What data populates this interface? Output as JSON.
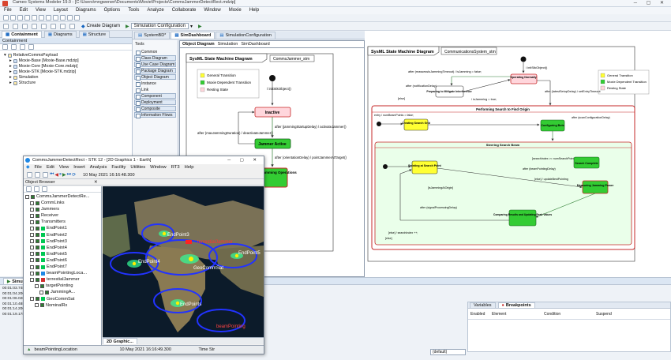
{
  "window": {
    "title": "Cameo Systems Modeler 19.0 - [C:\\Users\\mngweneri\\Documents\\Movie\\Projects\\CommsJammerDetectRect.mdzip]"
  },
  "menu": [
    "File",
    "Edit",
    "View",
    "Layout",
    "Diagrams",
    "Options",
    "Tools",
    "Analyze",
    "Collaborate",
    "Window",
    "Moxie",
    "Help"
  ],
  "toolbar2": {
    "create_diagram": "Create Diagram",
    "sim_config": "Simulation Configuration"
  },
  "left_tabs": [
    "Containment",
    "Diagrams",
    "Structure"
  ],
  "containment": {
    "header": "Containment",
    "items": [
      "RelativeCommsPayload",
      "Moxie-Base [Moxie-Base.mdzip]",
      "Moxie-Core [Moxie-Core.mdzip]",
      "Moxie-STK [Moxie-STK.mdzip]",
      "Simulation",
      "Structure"
    ]
  },
  "editor_tabs": [
    "SystemBD*",
    "SimDashboard",
    "SimulationConfiguration"
  ],
  "palette": {
    "section": "Tools",
    "items": [
      "Common",
      "Class Diagram",
      "Use Case Diagram",
      "Package Diagram",
      "Object Diagram",
      "Instance",
      "Link",
      "Component Diagram",
      "Deployment Diagram",
      "Composite Structure",
      "Information Flows"
    ]
  },
  "diagram1": {
    "tabs": [
      "Object Diagram",
      "Simulation",
      "SimDashboard"
    ],
    "frame_title": "SysML State Machine Diagram",
    "frame_name": "CommsJammer_stm",
    "legend": [
      {
        "label": "General Transition",
        "color": "#ffff33"
      },
      {
        "label": "Moxie Dependent Transition",
        "color": "#33cc33"
      },
      {
        "label": "Resting State",
        "color": "#ffd6dc"
      }
    ],
    "init_label": "/ initStkObject()",
    "states": {
      "inactive": "Inactive",
      "active_jammer": "Jammer Active",
      "active_ops": "Active Jamming Operations"
    },
    "transitions": {
      "t1": "after (jammingStartupDelay) / activateJammer()",
      "t2": "after (maxJammingDuration) / deactivateJammer()",
      "t3": "after (orientationDelay) / pointJammerAtTarget()"
    }
  },
  "diagram2": {
    "frame_title": "SysML State Machine Diagram",
    "frame_name": "CommunicationsSystem_stm",
    "legend": [
      {
        "label": "General Transition",
        "color": "#ffff33"
      },
      {
        "label": "Moxie Dependent Transition",
        "color": "#33cc33"
      },
      {
        "label": "Resting State",
        "color": "#ffd6dc"
      }
    ],
    "init_label": "/ initStkObject()",
    "states": {
      "operating": "Operating Normally",
      "preparing": "Preparing to Mitigate Interference",
      "perform": "Performing Search to Find Origin",
      "creating": "Creating Search Grid",
      "configuring": "Configuring Bots",
      "search_beam": "Steering Search Beam",
      "pointing": "Pointing at Search Point",
      "search_complete": "Search Complete",
      "measuring": "Measuring Jamming Power",
      "comparing": "Comparing Results and Updating Peak Values"
    },
    "transitions": {
      "t1": "after (reassessIsJammingTimeout) / isJamming = false;",
      "t2": "after (notificationDelay)",
      "t3": "/ isJamming = true;",
      "t4": "after (latestSetupDelay) / setEntryTimeout",
      "t5": "[else]",
      "t6": "entry / numBeamPoints = false;",
      "t7": "after (numberOfBotTasks)",
      "t8": "[isJammingAtOrigin]",
      "t9": "after (beamPointingDelay)",
      "t10": "[else] / updateBestPointing",
      "t11": "after (signalProcessingDelay)",
      "t12": "[else] / searchIndex ++;",
      "t13": "after (scanConfigurationDelay)",
      "t14": "[searchIndex >= numSearchPoints]"
    }
  },
  "stk": {
    "title": "CommsJammerDetectRect - STK 12 - [2D Graphics 1 - Earth]",
    "menu": [
      "File",
      "Edit",
      "View",
      "Insert",
      "Analysis",
      "Facility",
      "Utilities",
      "Window",
      "RT3",
      "Help"
    ],
    "time": "10 May 2021 16:16:48.300",
    "object_browser": "Object Browser",
    "objects": [
      {
        "label": "CommsJammerDetectRe...",
        "indent": 0,
        "color": ""
      },
      {
        "label": "CommLinks",
        "indent": 1,
        "color": ""
      },
      {
        "label": "Jammers",
        "indent": 1,
        "color": ""
      },
      {
        "label": "Receiver",
        "indent": 1,
        "color": ""
      },
      {
        "label": "Transmitters",
        "indent": 1,
        "color": ""
      },
      {
        "label": "EndPoint1",
        "indent": 1,
        "color": "#00c853"
      },
      {
        "label": "EndPoint2",
        "indent": 1,
        "color": "#00c853"
      },
      {
        "label": "EndPoint3",
        "indent": 1,
        "color": "#00c853"
      },
      {
        "label": "EndPoint4",
        "indent": 1,
        "color": "#00c853"
      },
      {
        "label": "EndPoint5",
        "indent": 1,
        "color": "#00c853"
      },
      {
        "label": "EndPoint6",
        "indent": 1,
        "color": "#00c853"
      },
      {
        "label": "EndPoint7",
        "indent": 1,
        "color": "#00c853"
      },
      {
        "label": "beamPointingLoca...",
        "indent": 1,
        "color": "#1e88e5"
      },
      {
        "label": "terrestialJammer",
        "indent": 1,
        "color": "#d32f2f"
      },
      {
        "label": "targetPointing",
        "indent": 2,
        "color": ""
      },
      {
        "label": "JammingA...",
        "indent": 3,
        "color": ""
      },
      {
        "label": "GeoCommSat",
        "indent": 1,
        "color": "#00c853"
      },
      {
        "label": "NominalRx",
        "indent": 2,
        "color": ""
      }
    ],
    "globe_labels": [
      "EndPoint3",
      "EndPoint4",
      "EndPoint5",
      "GeoCommSat",
      "EndPoints",
      "beamPointing",
      "terrestialJammer"
    ],
    "status_left": "beamPointingLocation",
    "status_time": "10 May 2021 16:16:49.300",
    "status_right": "Time Str",
    "view_tab": "2D Graphic..."
  },
  "bottom": {
    "tabs": [
      "Simulation"
    ],
    "rows": [
      "00:01:03.748",
      "00:01:04.200",
      "00:01:06.020",
      "00:01:10.488",
      "00:01:14.200",
      "00:01:19.178"
    ],
    "var_tabs": [
      "Variables",
      "Breakpoints"
    ],
    "var_cols": [
      "Enabled",
      "Element",
      "Condition",
      "Suspend"
    ],
    "default_label": "(default)"
  }
}
